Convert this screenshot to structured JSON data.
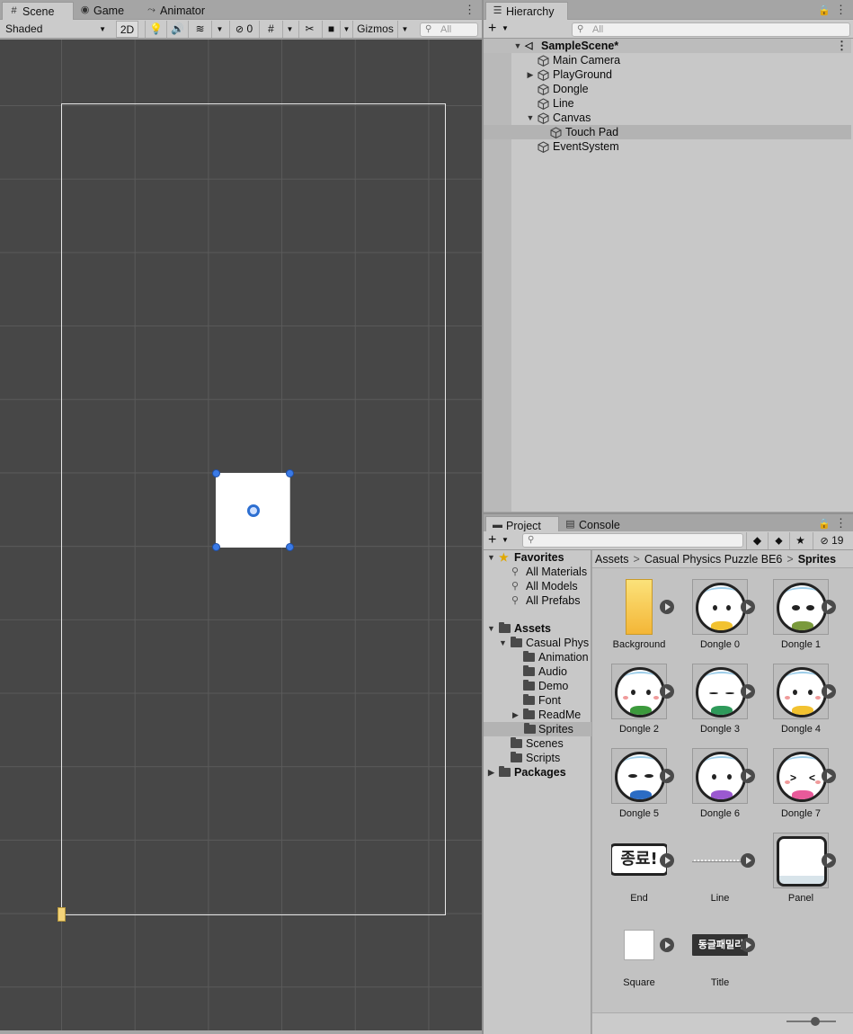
{
  "scene": {
    "tabs": [
      {
        "label": "Scene",
        "icon": "grid-icon"
      },
      {
        "label": "Game",
        "icon": "gamepad-icon"
      },
      {
        "label": "Animator",
        "icon": "animator-icon"
      }
    ],
    "shading_mode": "Shaded",
    "mode_2d_label": "2D",
    "hidden_count": "0",
    "gizmos_label": "Gizmos",
    "search_placeholder": "All"
  },
  "hierarchy": {
    "tab_label": "Hierarchy",
    "search_placeholder": "All",
    "items": [
      {
        "label": "SampleScene*",
        "expanded": true
      },
      {
        "label": "Main Camera"
      },
      {
        "label": "PlayGround",
        "collapsed": true
      },
      {
        "label": "Dongle"
      },
      {
        "label": "Line"
      },
      {
        "label": "Canvas",
        "expanded": true
      },
      {
        "label": "Touch Pad",
        "selected": true
      },
      {
        "label": "EventSystem"
      }
    ]
  },
  "project": {
    "tabs": [
      {
        "label": "Project",
        "icon": "folder-icon"
      },
      {
        "label": "Console",
        "icon": "console-icon"
      }
    ],
    "hidden_packages_count": "19",
    "favorites": {
      "label": "Favorites",
      "items": [
        "All Materials",
        "All Models",
        "All Prefabs"
      ]
    },
    "tree": {
      "assets_label": "Assets",
      "casual_folder": "Casual Phys",
      "subfolders": [
        "Animation",
        "Audio",
        "Demo",
        "Font",
        "ReadMe",
        "Sprites"
      ],
      "scenes": "Scenes",
      "scripts": "Scripts",
      "packages": "Packages"
    },
    "breadcrumb": [
      "Assets",
      "Casual Physics Puzzle BE6",
      "Sprites"
    ],
    "assets": [
      "Background",
      "Dongle 0",
      "Dongle 1",
      "Dongle 2",
      "Dongle 3",
      "Dongle 4",
      "Dongle 5",
      "Dongle 6",
      "Dongle 7",
      "End",
      "Line",
      "Panel",
      "Square",
      "Title"
    ],
    "end_sprite_text": "종료!",
    "title_sprite_text": "동글패밀리",
    "dongle_shirt_colors": [
      "#f2c230",
      "#7a9a3c",
      "#3c9a3c",
      "#2e9a5a",
      "#f2c230",
      "#2b6cc4",
      "#9b59d0",
      "#e85a9a"
    ]
  }
}
